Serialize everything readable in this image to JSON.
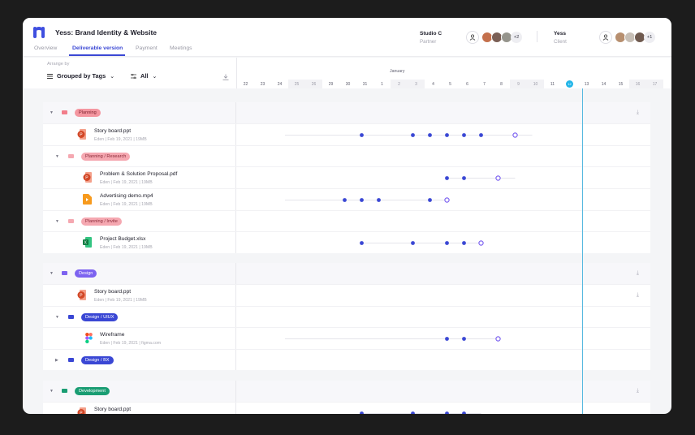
{
  "app": {
    "project_title": "Yess: Brand Identity & Website",
    "tabs": [
      "Overview",
      "Deliverable version",
      "Payment",
      "Meetings"
    ],
    "active_tab": "Deliverable version"
  },
  "parties": [
    {
      "name": "Studio C",
      "role": "Partner",
      "more": "+2"
    },
    {
      "name": "Yess",
      "role": "Client",
      "more": "+1"
    }
  ],
  "controls": {
    "arrange_label": "Arrange by",
    "group_by": "Grouped by Tags",
    "filter": "All"
  },
  "timeline": {
    "month": "January",
    "days": [
      "22",
      "23",
      "24",
      "25",
      "26",
      "29",
      "30",
      "31",
      "1",
      "2",
      "3",
      "4",
      "5",
      "6",
      "7",
      "8",
      "9",
      "10",
      "11",
      "12",
      "13",
      "14",
      "15",
      "16",
      "17"
    ],
    "today": "12"
  },
  "groups": [
    {
      "tag": "Planning",
      "color": "#f27d8a",
      "rows": [
        {
          "type": "file",
          "name": "Story board.ppt",
          "meta": "Eden | Feb 19, 2021 | 19MB",
          "icon": "powerpoint-icon"
        },
        {
          "type": "subtag",
          "tag": "Planning / Research"
        },
        {
          "type": "file",
          "name": "Problem & Solution Proposal.pdf",
          "meta": "Eden | Feb 19, 2021 | 19MB",
          "icon": "powerpoint-icon"
        },
        {
          "type": "file",
          "name": "Advertising demo.mp4",
          "meta": "Eden | Feb 19, 2021 | 19MB",
          "icon": "video-file-icon"
        },
        {
          "type": "subtag",
          "tag": "Planning / Invite"
        },
        {
          "type": "file",
          "name": "Project Budget.xlsx",
          "meta": "Eden | Feb 19, 2021 | 19MB",
          "icon": "excel-icon"
        }
      ]
    },
    {
      "tag": "Design",
      "color": "#7d63f0",
      "rows": [
        {
          "type": "file",
          "name": "Story board.ppt",
          "meta": "Eden | Feb 19, 2021 | 19MB",
          "icon": "powerpoint-icon"
        },
        {
          "type": "subtag",
          "tag": "Design / UIUX"
        },
        {
          "type": "file",
          "name": "Wireframe",
          "meta": "Eden | Feb 19, 2021 | figma.com",
          "icon": "figma-icon"
        },
        {
          "type": "subtag",
          "tag": "Design / BX"
        }
      ]
    },
    {
      "tag": "Development",
      "color": "#1a9d73",
      "rows": [
        {
          "type": "file",
          "name": "Story board.ppt",
          "meta": "",
          "icon": "powerpoint-icon"
        }
      ]
    }
  ]
}
